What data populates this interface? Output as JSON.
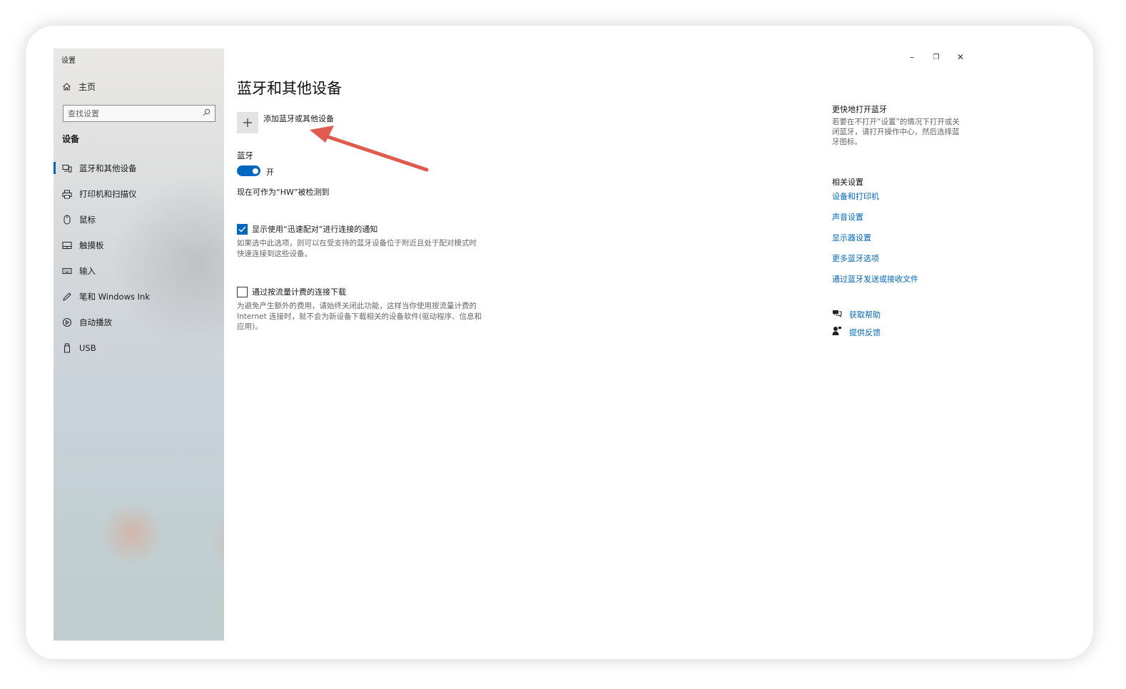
{
  "window": {
    "title": "设置"
  },
  "sidebar": {
    "home_label": "主页",
    "search_placeholder": "查找设置",
    "section_label": "设备",
    "items": [
      {
        "label": "蓝牙和其他设备",
        "icon": "bluetooth-devices-icon",
        "active": true
      },
      {
        "label": "打印机和扫描仪",
        "icon": "printer-icon"
      },
      {
        "label": "鼠标",
        "icon": "mouse-icon"
      },
      {
        "label": "触摸板",
        "icon": "touchpad-icon"
      },
      {
        "label": "输入",
        "icon": "keyboard-icon"
      },
      {
        "label": "笔和 Windows Ink",
        "icon": "pen-icon"
      },
      {
        "label": "自动播放",
        "icon": "autoplay-icon"
      },
      {
        "label": "USB",
        "icon": "usb-icon"
      }
    ]
  },
  "main": {
    "title": "蓝牙和其他设备",
    "add_device_label": "添加蓝牙或其他设备",
    "bluetooth_label": "蓝牙",
    "toggle_state": "开",
    "discoverable_text": "现在可作为“HW”被检测到",
    "swift_pair": {
      "label": "显示使用“迅速配对”进行连接的通知",
      "checked": true,
      "description": "如果选中此选项，则可以在受支持的蓝牙设备位于附近且处于配对模式时快速连接到这些设备。"
    },
    "metered": {
      "label": "通过按流量计费的连接下载",
      "checked": false,
      "description": "为避免产生额外的费用，请始终关闭此功能，这样当你使用按流量计费的 Internet 连接时，就不会为新设备下载相关的设备软件(驱动程序、信息和应用)。"
    }
  },
  "right_panel": {
    "quick_title": "更快地打开蓝牙",
    "quick_desc": "若要在不打开“设置”的情况下打开或关闭蓝牙，请打开操作中心，然后选择蓝牙图标。",
    "related_title": "相关设置",
    "links": [
      "设备和打印机",
      "声音设置",
      "显示器设置",
      "更多蓝牙选项",
      "通过蓝牙发送或接收文件"
    ],
    "help_label": "获取帮助",
    "feedback_label": "提供反馈"
  },
  "window_controls": {
    "minimize": "–",
    "restore": "❐",
    "close": "✕"
  },
  "colors": {
    "accent": "#0067c0",
    "annotation_arrow": "#e05a4e"
  }
}
